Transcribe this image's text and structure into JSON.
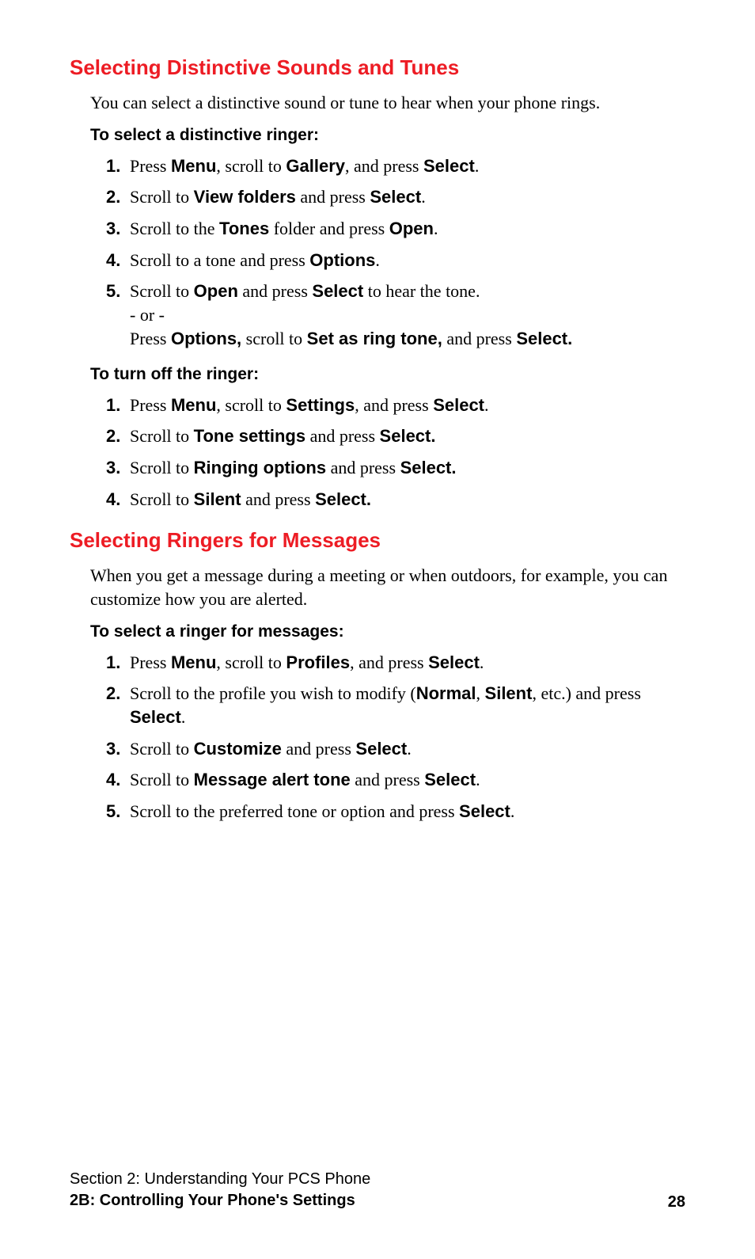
{
  "section1": {
    "heading": "Selecting Distinctive Sounds and Tunes",
    "intro": "You can select a distinctive sound or tune to hear when your phone rings.",
    "sub1": "To select a distinctive ringer:",
    "list1": {
      "n1": "1.",
      "t1a": "Press ",
      "t1b": "Menu",
      "t1c": ", scroll to ",
      "t1d": "Gallery",
      "t1e": ", and press ",
      "t1f": "Select",
      "t1g": ".",
      "n2": "2.",
      "t2a": "Scroll to ",
      "t2b": "View folders",
      "t2c": " and press ",
      "t2d": "Select",
      "t2e": ".",
      "n3": "3.",
      "t3a": "Scroll to the ",
      "t3b": "Tones",
      "t3c": " folder and press ",
      "t3d": "Open",
      "t3e": ".",
      "n4": "4.",
      "t4a": "Scroll to a tone and press ",
      "t4b": "Options",
      "t4c": ".",
      "n5": "5.",
      "t5a": "Scroll to ",
      "t5b": "Open",
      "t5c": " and press ",
      "t5d": "Select",
      "t5e": " to hear the tone.",
      "t5or": "- or -",
      "t5f": "Press ",
      "t5g": "Options,",
      "t5h": " scroll to ",
      "t5i": "Set as ring tone,",
      "t5j": " and press ",
      "t5k": "Select."
    },
    "sub2": "To turn off the ringer:",
    "list2": {
      "n1": "1.",
      "t1a": "Press ",
      "t1b": "Menu",
      "t1c": ", scroll to ",
      "t1d": "Settings",
      "t1e": ", and press ",
      "t1f": "Select",
      "t1g": ".",
      "n2": "2.",
      "t2a": "Scroll to ",
      "t2b": "Tone settings",
      "t2c": " and press ",
      "t2d": "Select.",
      "n3": "3.",
      "t3a": "Scroll to ",
      "t3b": "Ringing options",
      "t3c": " and press ",
      "t3d": "Select.",
      "n4": "4.",
      "t4a": "Scroll to ",
      "t4b": "Silent",
      "t4c": " and press ",
      "t4d": "Select."
    }
  },
  "section2": {
    "heading": "Selecting Ringers for Messages",
    "intro": "When you get a message during a meeting or when outdoors, for example, you can customize how you are alerted.",
    "sub1": "To select a ringer for messages:",
    "list1": {
      "n1": "1.",
      "t1a": "Press ",
      "t1b": "Menu",
      "t1c": ", scroll to ",
      "t1d": "Profiles",
      "t1e": ", and press ",
      "t1f": "Select",
      "t1g": ".",
      "n2": "2.",
      "t2a": "Scroll to the profile you wish to modify (",
      "t2b": "Normal",
      "t2c": ", ",
      "t2d": "Silent",
      "t2e": ", etc.) and press ",
      "t2f": "Select",
      "t2g": ".",
      "n3": "3.",
      "t3a": "Scroll to ",
      "t3b": "Customize",
      "t3c": " and press ",
      "t3d": "Select",
      "t3e": ".",
      "n4": "4.",
      "t4a": "Scroll to ",
      "t4b": "Message alert tone",
      "t4c": " and press ",
      "t4d": "Select",
      "t4e": ".",
      "n5": "5.",
      "t5a": "Scroll to the preferred tone or option and press ",
      "t5b": "Select",
      "t5c": "."
    }
  },
  "footer": {
    "line1": "Section 2: Understanding Your PCS Phone",
    "line2": "2B: Controlling Your Phone's Settings",
    "page": "28"
  }
}
